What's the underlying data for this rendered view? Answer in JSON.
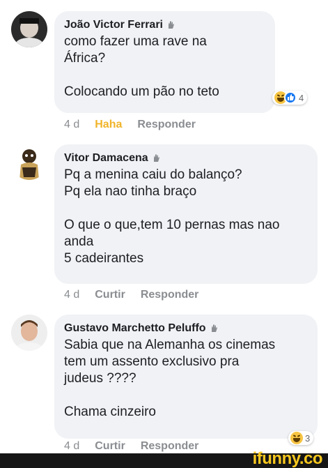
{
  "comments": [
    {
      "author": "João Victor Ferrari",
      "text": "como fazer uma rave na\nÁfrica?\n\nColocando um pão no teto",
      "time": "4 d",
      "reaction_label": "Haha",
      "reply_label": "Responder",
      "reaction_count": "4",
      "reactions": [
        "haha-icon",
        "like-icon"
      ]
    },
    {
      "author": "Vitor Damacena",
      "text": "Pq a menina caiu do balanço?\nPq ela nao tinha braço\n\nO que o que,tem 10 pernas mas nao\nanda\n5 cadeirantes",
      "time": "4 d",
      "reaction_label": "Curtir",
      "reply_label": "Responder"
    },
    {
      "author": "Gustavo Marchetto Peluffo",
      "text": "Sabia que na Alemanha os cinemas\ntem um assento exclusivo pra\njudeus ????\n\nChama cinzeiro",
      "time": "4 d",
      "reaction_label": "Curtir",
      "reply_label": "Responder",
      "reaction_count": "3",
      "reactions": [
        "haha-icon"
      ]
    }
  ],
  "watermark": "ifunny.co",
  "colors": {
    "bubble": "#f0f2f5",
    "action_gray": "#8a8d91",
    "haha_yellow": "#f0b429",
    "like_blue": "#1877f2",
    "logo_yellow": "#f8c81e"
  }
}
